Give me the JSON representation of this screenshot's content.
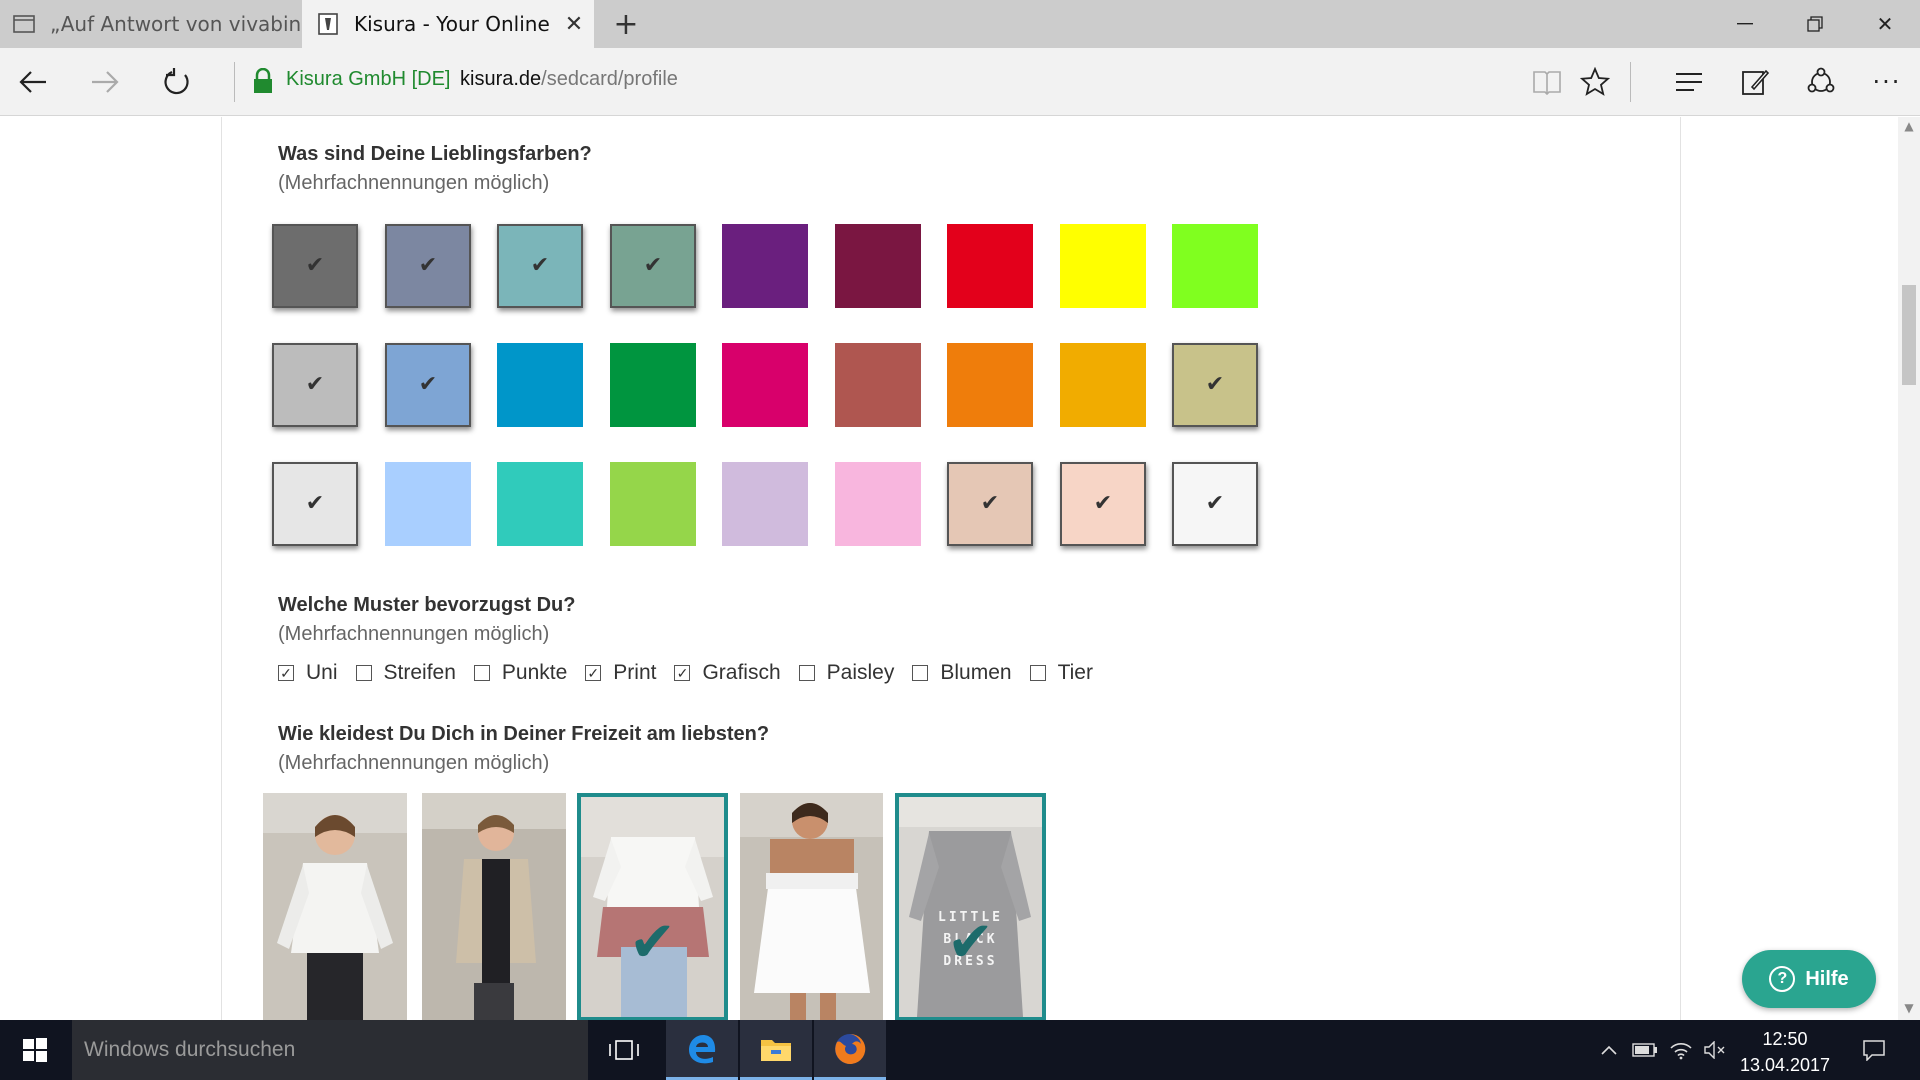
{
  "browser": {
    "tabs": [
      {
        "label": "„Auf Antwort von vivabini.d"
      },
      {
        "label": "Kisura - Your Online Sty"
      }
    ],
    "ev_cert": "Kisura GmbH [DE]",
    "url_host": "kisura.de",
    "url_path": "/sedcard/profile"
  },
  "colors_question": {
    "title": "Was sind Deine Lieblingsfarben?",
    "subtitle": "(Mehrfachnennungen möglich)",
    "rows": [
      [
        {
          "color": "#6d6d6d",
          "selected": true
        },
        {
          "color": "#7c87a1",
          "selected": true
        },
        {
          "color": "#7bb5b9",
          "selected": true
        },
        {
          "color": "#78a392",
          "selected": true
        },
        {
          "color": "#6a1f7e",
          "selected": false
        },
        {
          "color": "#7a1641",
          "selected": false
        },
        {
          "color": "#e3001b",
          "selected": false
        },
        {
          "color": "#ffff00",
          "selected": false
        },
        {
          "color": "#80ff1f",
          "selected": false
        }
      ],
      [
        {
          "color": "#bcbcbc",
          "selected": true
        },
        {
          "color": "#7ea5d4",
          "selected": true
        },
        {
          "color": "#0096c9",
          "selected": false
        },
        {
          "color": "#00953f",
          "selected": false
        },
        {
          "color": "#d8006b",
          "selected": false
        },
        {
          "color": "#af5650",
          "selected": false
        },
        {
          "color": "#ef7d0b",
          "selected": false
        },
        {
          "color": "#f1ac00",
          "selected": false
        },
        {
          "color": "#c8c28a",
          "selected": true
        }
      ],
      [
        {
          "color": "#e6e6e6",
          "selected": true
        },
        {
          "color": "#a9cfff",
          "selected": false
        },
        {
          "color": "#30cbbb",
          "selected": false
        },
        {
          "color": "#95d64a",
          "selected": false
        },
        {
          "color": "#d0bbdd",
          "selected": false
        },
        {
          "color": "#f8b6de",
          "selected": false
        },
        {
          "color": "#e5c7b5",
          "selected": true
        },
        {
          "color": "#f7d5c6",
          "selected": true
        },
        {
          "color": "#f6f6f6",
          "selected": true
        }
      ]
    ]
  },
  "patterns_question": {
    "title": "Welche Muster bevorzugst Du?",
    "subtitle": "(Mehrfachnennungen möglich)",
    "options": [
      {
        "label": "Uni",
        "checked": true
      },
      {
        "label": "Streifen",
        "checked": false
      },
      {
        "label": "Punkte",
        "checked": false
      },
      {
        "label": "Print",
        "checked": true
      },
      {
        "label": "Grafisch",
        "checked": true
      },
      {
        "label": "Paisley",
        "checked": false
      },
      {
        "label": "Blumen",
        "checked": false
      },
      {
        "label": "Tier",
        "checked": false
      }
    ]
  },
  "leisure_question": {
    "title": "Wie kleidest Du Dich in Deiner Freizeit am liebsten?",
    "subtitle": "(Mehrfachnennungen möglich)",
    "outfits": [
      {
        "selected": false
      },
      {
        "selected": false
      },
      {
        "selected": true
      },
      {
        "selected": false
      },
      {
        "selected": true
      }
    ],
    "dress_print": [
      "LITTLE",
      "BLACK",
      "DRESS"
    ]
  },
  "help_button": {
    "label": "Hilfe"
  },
  "taskbar": {
    "search_placeholder": "Windows durchsuchen",
    "time": "12:50",
    "date": "13.04.2017"
  },
  "icons": {
    "check": "✔",
    "checkbox_checked": "☑",
    "checkbox_unchecked": "☐"
  }
}
